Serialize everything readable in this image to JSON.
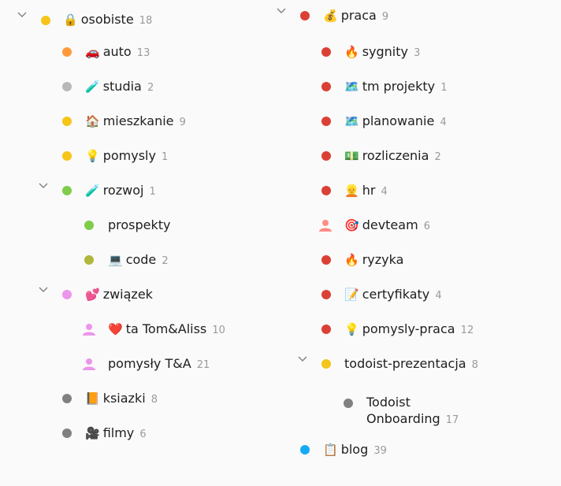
{
  "colors": {
    "yellow": "#f5c518",
    "orange": "#ff9a3c",
    "grey": "#b8b8b8",
    "dark_grey": "#808080",
    "green": "#7ecc49",
    "olive": "#afb83b",
    "pink": "#eb96eb",
    "red": "#db4035",
    "salmon": "#ff8d85",
    "blue": "#14aaf5",
    "pink_person": "#eb96eb"
  },
  "left": [
    {
      "name": "osobiste",
      "emoji": "🔒",
      "count": "18",
      "dot": "yellow",
      "expanded": true
    },
    {
      "name": "auto",
      "emoji": "🚗",
      "count": "13",
      "dot": "orange"
    },
    {
      "name": "studia",
      "emoji": "🧪",
      "count": "2",
      "dot": "grey"
    },
    {
      "name": "mieszkanie",
      "emoji": "🏠",
      "count": "9",
      "dot": "yellow"
    },
    {
      "name": "pomysly",
      "emoji": "💡",
      "count": "1",
      "dot": "yellow"
    },
    {
      "name": "rozwoj",
      "emoji": "🧪",
      "count": "1",
      "dot": "green",
      "expanded": true
    },
    {
      "name": "prospekty",
      "emoji": "",
      "count": "",
      "dot": "green"
    },
    {
      "name": "code",
      "emoji": "💻",
      "count": "2",
      "dot": "olive"
    },
    {
      "name": "związek",
      "emoji": "💕",
      "count": "",
      "dot": "pink",
      "expanded": true
    },
    {
      "name": "ta Tom&Aliss",
      "emoji": "❤️",
      "count": "10",
      "dot": "pink_person",
      "shared": true
    },
    {
      "name": "pomysły T&A",
      "emoji": "",
      "count": "21",
      "dot": "pink_person",
      "shared": true
    },
    {
      "name": "ksiazki",
      "emoji": "📙",
      "count": "8",
      "dot": "dark_grey"
    },
    {
      "name": "filmy",
      "emoji": "🎥",
      "count": "6",
      "dot": "dark_grey"
    }
  ],
  "right": [
    {
      "name": "praca",
      "emoji": "💰",
      "count": "9",
      "dot": "red",
      "expanded": true
    },
    {
      "name": "sygnity",
      "emoji": "🔥",
      "count": "3",
      "dot": "red"
    },
    {
      "name": "tm projekty",
      "emoji": "🗺️",
      "count": "1",
      "dot": "red"
    },
    {
      "name": "planowanie",
      "emoji": "🗺️",
      "count": "4",
      "dot": "red"
    },
    {
      "name": "rozliczenia",
      "emoji": "💵",
      "count": "2",
      "dot": "red"
    },
    {
      "name": "hr",
      "emoji": "👱",
      "count": "4",
      "dot": "red"
    },
    {
      "name": "devteam",
      "emoji": "🎯",
      "count": "6",
      "dot": "salmon",
      "shared": true
    },
    {
      "name": "ryzyka",
      "emoji": "🔥",
      "count": "",
      "dot": "red"
    },
    {
      "name": "certyfikaty",
      "emoji": "📝",
      "count": "4",
      "dot": "red"
    },
    {
      "name": "pomysly-praca",
      "emoji": "💡",
      "count": "12",
      "dot": "red"
    },
    {
      "name": "todoist-prezentacja",
      "emoji": "",
      "count": "8",
      "dot": "yellow",
      "expanded": true
    },
    {
      "name": "Todoist Onboarding",
      "emoji": "",
      "count": "17",
      "dot": "dark_grey"
    },
    {
      "name": "blog",
      "emoji": "📋",
      "count": "39",
      "dot": "blue"
    }
  ]
}
